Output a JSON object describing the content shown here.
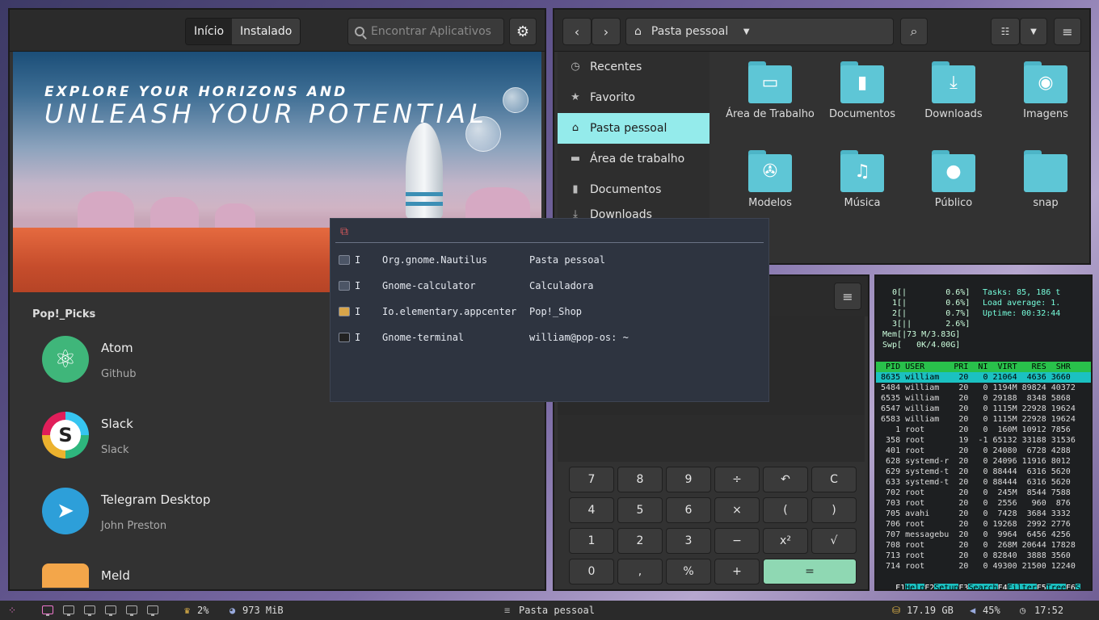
{
  "shop": {
    "tabs": [
      {
        "label": "Início"
      },
      {
        "label": "Instalado"
      }
    ],
    "search_placeholder": "Encontrar Aplicativos",
    "banner": {
      "line1": "EXPLORE YOUR HORIZONS AND",
      "line2": "UNLEASH YOUR POTENTIAL"
    },
    "picks_title": "Pop!_Picks",
    "apps": [
      {
        "name": "Atom",
        "developer": "Github",
        "color": "#3fb67a"
      },
      {
        "name": "Slack",
        "developer": "Slack",
        "color": "#ffffff"
      },
      {
        "name": "Telegram Desktop",
        "developer": "John Preston",
        "color": "#2d9fd9"
      },
      {
        "name": "Meld",
        "developer": "",
        "color": "#f3a64a"
      }
    ]
  },
  "files": {
    "location": "Pasta pessoal",
    "sidebar": [
      {
        "label": "Recentes",
        "icon": "clock-icon"
      },
      {
        "label": "Favorito",
        "icon": "star-icon"
      },
      {
        "label": "Pasta pessoal",
        "icon": "home-icon"
      },
      {
        "label": "Área de trabalho",
        "icon": "desktop-icon"
      },
      {
        "label": "Documentos",
        "icon": "document-icon"
      },
      {
        "label": "Downloads",
        "icon": "download-icon"
      }
    ],
    "folders": [
      {
        "label": "Área de Trabalho",
        "icon": "desktop-folder-icon"
      },
      {
        "label": "Documentos",
        "icon": "documents-folder-icon"
      },
      {
        "label": "Downloads",
        "icon": "downloads-folder-icon"
      },
      {
        "label": "Imagens",
        "icon": "pictures-folder-icon"
      },
      {
        "label": "Modelos",
        "icon": "templates-folder-icon"
      },
      {
        "label": "Música",
        "icon": "music-folder-icon"
      },
      {
        "label": "Público",
        "icon": "public-folder-icon"
      },
      {
        "label": "snap",
        "icon": "folder-icon"
      }
    ]
  },
  "calc": {
    "keys": [
      "7",
      "8",
      "9",
      "÷",
      "↶",
      "C",
      "4",
      "5",
      "6",
      "×",
      "(",
      ")",
      "1",
      "2",
      "3",
      "−",
      "x²",
      "√",
      "0",
      ",",
      "%",
      "+",
      "="
    ]
  },
  "htop": {
    "meters": [
      " 0[|        0.6%]",
      " 1[|        0.6%]",
      " 2[|        0.7%]",
      " 3[||       2.6%]",
      "Mem[|73 M/3.83G]",
      "Swp[   0K/4.00G]"
    ],
    "tasks": "Tasks: 85, 186 t",
    "load": "Load average: 1.",
    "uptime": "Uptime: 00:32:44",
    "header": "  PID USER      PRI  NI  VIRT   RES  SHR",
    "rows": [
      " 8635 william    20   0 21064  4636 3660",
      " 5484 william    20   0 1194M 89824 40372",
      " 6535 william    20   0 29188  8348 5868",
      " 6547 william    20   0 1115M 22928 19624",
      " 6583 william    20   0 1115M 22928 19624",
      "    1 root       20   0  160M 10912 7856",
      "  358 root       19  -1 65132 33188 31536",
      "  401 root       20   0 24080  6728 4288",
      "  628 systemd-r  20   0 24096 11916 8012",
      "  629 systemd-t  20   0 88444  6316 5620",
      "  633 systemd-t  20   0 88444  6316 5620",
      "  702 root       20   0  245M  8544 7588",
      "  703 root       20   0  2556   960  876",
      "  705 avahi      20   0  7428  3684 3332",
      "  706 root       20   0 19268  2992 2776",
      "  707 messagebu  20   0  9964  6456 4256",
      "  708 root       20   0  268M 20644 17828",
      "  713 root       20   0 82840  3888 3560",
      "  714 root       20   0 49300 21500 12240"
    ],
    "fkeys": [
      {
        "key": "F1",
        "label": "Help"
      },
      {
        "key": "F2",
        "label": "Setup"
      },
      {
        "key": "F3",
        "label": "Search"
      },
      {
        "key": "F4",
        "label": "Filter"
      },
      {
        "key": "F5",
        "label": "Tree"
      },
      {
        "key": "F6",
        "label": "S"
      }
    ]
  },
  "switcher": {
    "items": [
      {
        "key": "I",
        "class": "Org.gnome.Nautilus",
        "title": "Pasta pessoal"
      },
      {
        "key": "I",
        "class": "Gnome-calculator",
        "title": "Calculadora"
      },
      {
        "key": "I",
        "class": "Io.elementary.appcenter",
        "title": "Pop!_Shop"
      },
      {
        "key": "I",
        "class": "Gnome-terminal",
        "title": "william@pop-os: ~"
      }
    ]
  },
  "panel": {
    "cpu": "2%",
    "memory": "973 MiB",
    "active_window": "Pasta pessoal",
    "disk": "17.19 GB",
    "volume": "45%",
    "clock": "17:52"
  }
}
